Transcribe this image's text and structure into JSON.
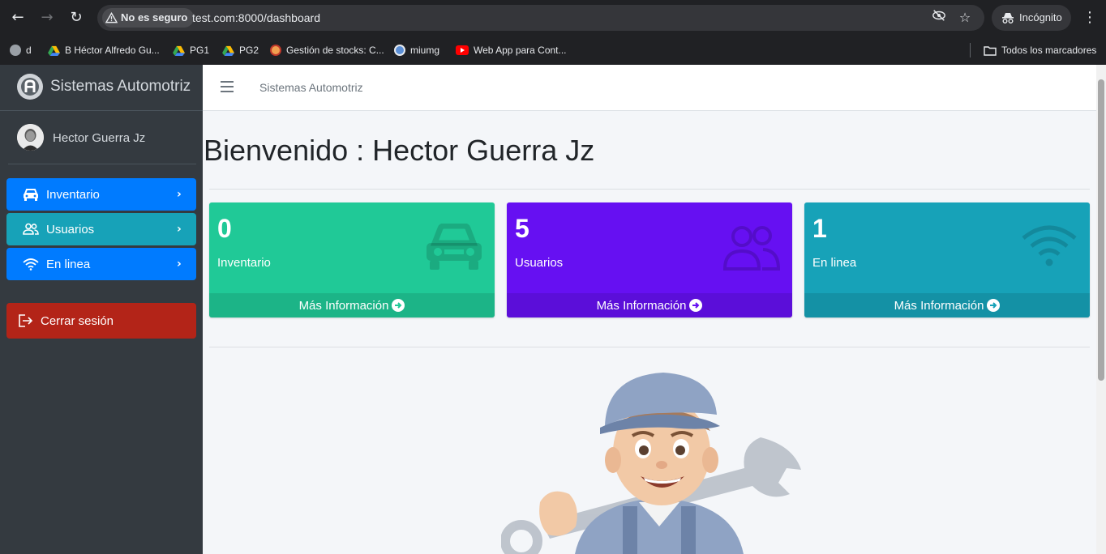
{
  "browser": {
    "security_chip": "No es seguro",
    "url": "test.com:8000/dashboard",
    "incognito_label": "Incógnito",
    "bookmarks": [
      {
        "label": "d",
        "icon": "globe-icon"
      },
      {
        "label": "B Héctor Alfredo Gu...",
        "icon": "google-drive-icon"
      },
      {
        "label": "PG1",
        "icon": "google-drive-icon"
      },
      {
        "label": "PG2",
        "icon": "google-drive-icon"
      },
      {
        "label": "Gestión de stocks: C...",
        "icon": "site-icon"
      },
      {
        "label": "miumg",
        "icon": "site-icon"
      },
      {
        "label": "Web App para Cont...",
        "icon": "youtube-icon"
      }
    ],
    "all_bookmarks": "Todos los marcadores"
  },
  "sidebar": {
    "brand": "Sistemas Automotriz",
    "user_name": "Hector Guerra Jz",
    "items": [
      {
        "label": "Inventario",
        "icon": "car-icon",
        "color": "#007bff"
      },
      {
        "label": "Usuarios",
        "icon": "users-icon",
        "color": "#17a2b8"
      },
      {
        "label": "En linea",
        "icon": "wifi-icon",
        "color": "#007bff"
      }
    ],
    "logout": "Cerrar sesión",
    "logout_color": "#b32418"
  },
  "main": {
    "topbar_title": "Sistemas Automotriz",
    "welcome": "Bienvenido : Hector Guerra Jz",
    "boxes": [
      {
        "value": "0",
        "label": "Inventario",
        "footer": "Más Información",
        "color": "#20c997",
        "icon": "car-icon"
      },
      {
        "value": "5",
        "label": "Usuarios",
        "footer": "Más Información",
        "color": "#6610f2",
        "icon": "users-icon"
      },
      {
        "value": "1",
        "label": "En linea",
        "footer": "Más Información",
        "color": "#17a2b8",
        "icon": "wifi-icon"
      }
    ]
  }
}
